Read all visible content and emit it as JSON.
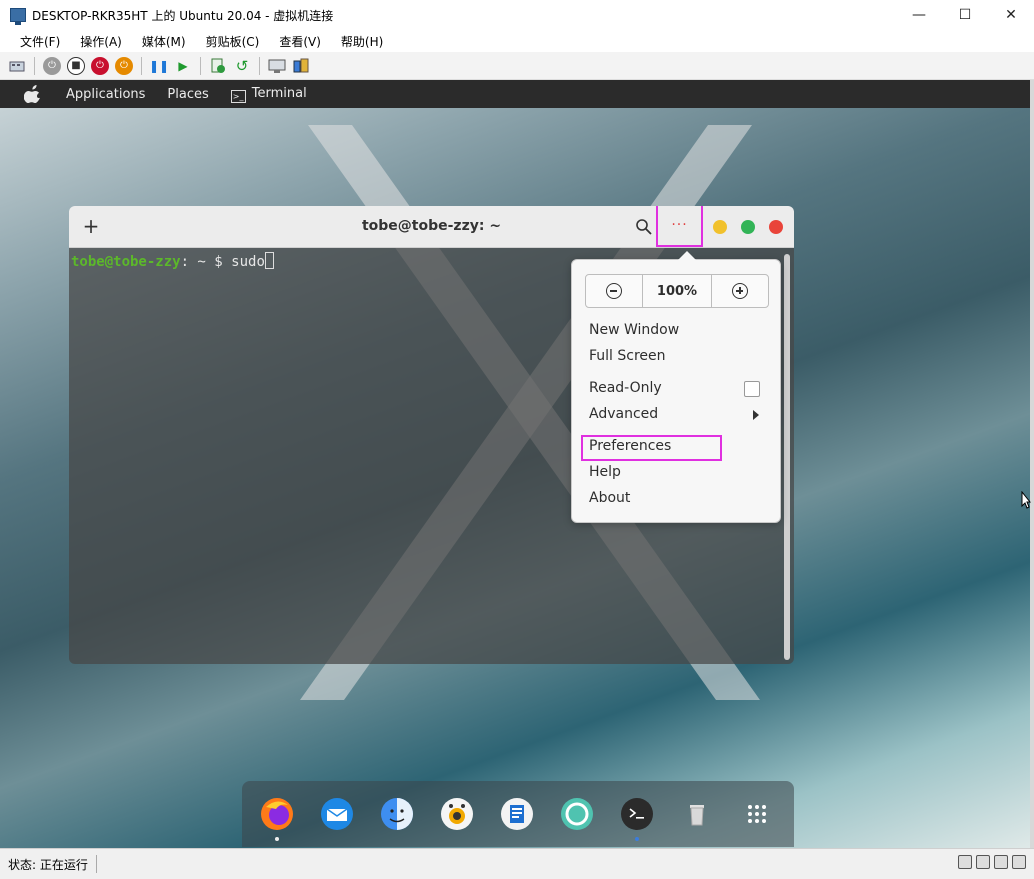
{
  "window": {
    "title": "DESKTOP-RKR35HT 上的 Ubuntu 20.04 - 虚拟机连接",
    "minimize": "—",
    "maximize": "☐",
    "close": "✕"
  },
  "menubar": {
    "items": [
      "文件(F)",
      "操作(A)",
      "媒体(M)",
      "剪贴板(C)",
      "查看(V)",
      "帮助(H)"
    ]
  },
  "ubuntu_topbar": {
    "items": [
      "Applications",
      "Places",
      "Terminal"
    ]
  },
  "terminal": {
    "title": "tobe@tobe-zzy: ~",
    "new_tab": "+",
    "more": "···",
    "prompt_user": "tobe@tobe-zzy",
    "prompt_rest": ": ~",
    "prompt_symbol": " $ ",
    "command": "sudo",
    "colors": {
      "close": "#e9443a",
      "maximize": "#32b457",
      "minimize": "#f1c12c",
      "prompt": "#5cb82a"
    }
  },
  "popover": {
    "zoom_value": "100%",
    "items": {
      "new_window": "New Window",
      "full_screen": "Full Screen",
      "read_only": "Read-Only",
      "advanced": "Advanced",
      "preferences": "Preferences",
      "help": "Help",
      "about": "About"
    }
  },
  "dock": {
    "items": [
      "firefox-icon",
      "mail-icon",
      "finder-icon",
      "screenshot-icon",
      "document-viewer-icon",
      "help-icon",
      "terminal-icon",
      "trash-icon",
      "app-grid-icon"
    ]
  },
  "statusbar": {
    "status": "状态: 正在运行"
  },
  "accent": {
    "highlight": "#e030e0"
  }
}
